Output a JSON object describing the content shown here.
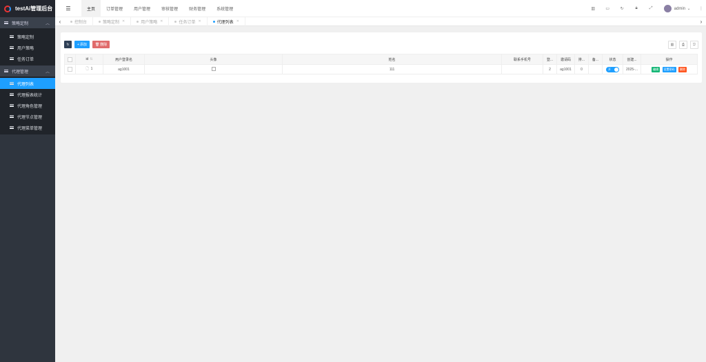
{
  "app": {
    "title": "testAi管理后台"
  },
  "sidebar": {
    "groups": [
      {
        "label": "策略定制",
        "items": [
          {
            "label": "策略定制"
          },
          {
            "label": "用户策略"
          },
          {
            "label": "任务订单"
          }
        ]
      },
      {
        "label": "代理管理",
        "items": [
          {
            "label": "代理列表",
            "active": true
          },
          {
            "label": "代理报表统计"
          },
          {
            "label": "代理角色管理"
          },
          {
            "label": "代理节点管理"
          },
          {
            "label": "代理菜单管理"
          }
        ]
      }
    ]
  },
  "header": {
    "nav": [
      "主页",
      "订单管理",
      "用户管理",
      "审核管理",
      "财务管理",
      "系统管理"
    ],
    "user": "admin"
  },
  "tabs": [
    {
      "label": "控制台",
      "active": false
    },
    {
      "label": "策略定制",
      "active": false
    },
    {
      "label": "用户策略",
      "active": false
    },
    {
      "label": "任务订单",
      "active": false
    },
    {
      "label": "代理列表",
      "active": true
    }
  ],
  "toolbar": {
    "add_label": "添加",
    "delete_label": "删除"
  },
  "table": {
    "columns": [
      "id",
      "用户登录名",
      "头像",
      "姓名",
      "联系手机号",
      "登...",
      "邀请码",
      "排...",
      "备...",
      "状态",
      "创建...",
      "操作"
    ],
    "rows": [
      {
        "id": "1",
        "username": "ag1001",
        "name": "111",
        "phone": "",
        "login": "2",
        "invite": "ag1001",
        "sort": "0",
        "note": "",
        "status_label": "开",
        "created": "2025-...",
        "ops": [
          "编辑",
          "设置密码",
          "删除"
        ]
      }
    ]
  },
  "colors": {
    "accent": "#1e9fff",
    "sidebar": "#2f353e",
    "danger": "#e06b6b",
    "edit": "#16b777"
  }
}
